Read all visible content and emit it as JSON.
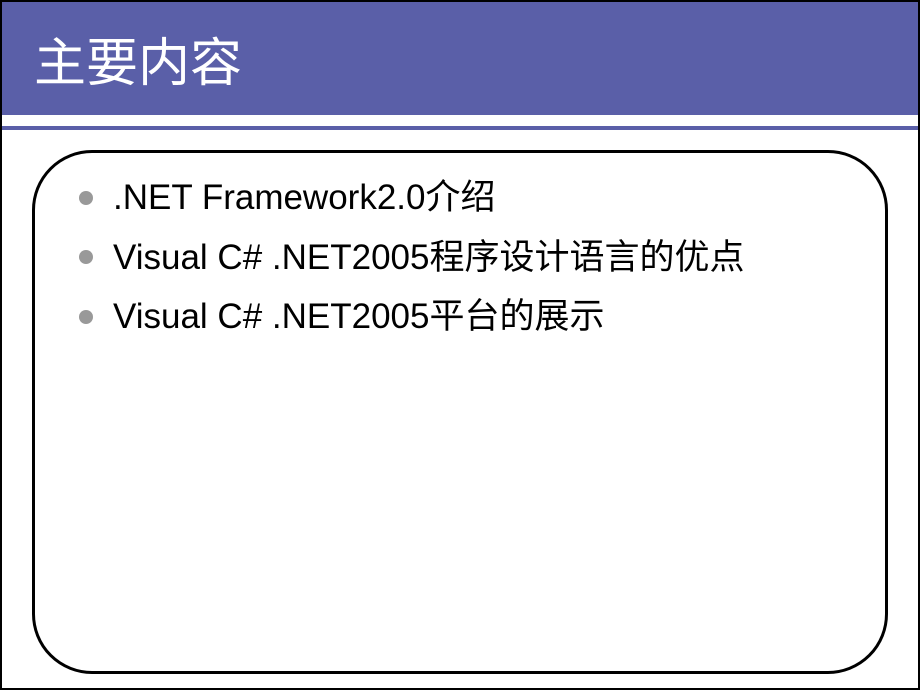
{
  "slide": {
    "title": "主要内容",
    "bullets": [
      ".NET Framework2.0介绍",
      "Visual C# .NET2005程序设计语言的优点",
      "Visual C# .NET2005平台的展示"
    ]
  }
}
